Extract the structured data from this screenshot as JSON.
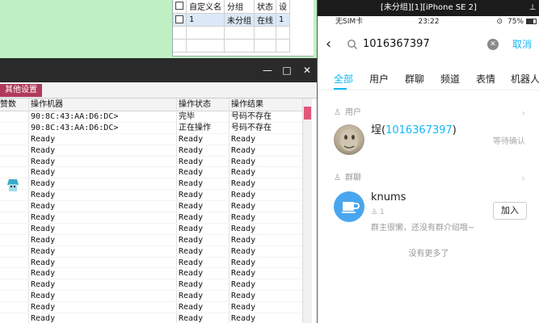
{
  "top_table": {
    "headers": [
      "",
      "自定义名",
      "分组",
      "状态",
      "设"
    ],
    "row": {
      "name": "1",
      "group": "未分组",
      "status": "在线",
      "extra": "1"
    }
  },
  "main_window": {
    "menu_tab": "其他设置",
    "columns": [
      "赞数",
      "操作机器",
      "操作状态",
      "操作结果"
    ],
    "rows": [
      {
        "machine": "90:8C:43:AA:D6:DC>",
        "state": "完毕",
        "result": "号码不存在"
      },
      {
        "machine": "90:8C:43:AA:D6:DC>",
        "state": "正在操作",
        "result": "号码不存在"
      },
      {
        "machine": "Ready",
        "state": "Ready",
        "result": "Ready"
      },
      {
        "machine": "Ready",
        "state": "Ready",
        "result": "Ready"
      },
      {
        "machine": "Ready",
        "state": "Ready",
        "result": "Ready"
      },
      {
        "machine": "Ready",
        "state": "Ready",
        "result": "Ready"
      },
      {
        "machine": "Ready",
        "state": "Ready",
        "result": "Ready"
      },
      {
        "machine": "Ready",
        "state": "Ready",
        "result": "Ready"
      },
      {
        "machine": "Ready",
        "state": "Ready",
        "result": "Ready"
      },
      {
        "machine": "Ready",
        "state": "Ready",
        "result": "Ready"
      },
      {
        "machine": "Ready",
        "state": "Ready",
        "result": "Ready"
      },
      {
        "machine": "Ready",
        "state": "Ready",
        "result": "Ready"
      },
      {
        "machine": "Ready",
        "state": "Ready",
        "result": "Ready"
      },
      {
        "machine": "Ready",
        "state": "Ready",
        "result": "Ready"
      },
      {
        "machine": "Ready",
        "state": "Ready",
        "result": "Ready"
      },
      {
        "machine": "Ready",
        "state": "Ready",
        "result": "Ready"
      },
      {
        "machine": "Ready",
        "state": "Ready",
        "result": "Ready"
      },
      {
        "machine": "Ready",
        "state": "Ready",
        "result": "Ready"
      },
      {
        "machine": "Ready",
        "state": "Ready",
        "result": "Ready"
      }
    ],
    "window_buttons": {
      "minimize": "—",
      "maximize": "□",
      "close": "✕"
    }
  },
  "phone": {
    "title": "[未分组][1][iPhone SE 2]",
    "pin_icon": "pin-icon",
    "status": {
      "carrier": "无SIM卡",
      "time": "23:22",
      "battery": "75%"
    },
    "search": {
      "query": "1016367397",
      "cancel": "取消"
    },
    "tabs": [
      "全部",
      "用户",
      "群聊",
      "频道",
      "表情",
      "机器人"
    ],
    "active_tab": 0,
    "sections": {
      "users": "用户",
      "groups": "群聊"
    },
    "user": {
      "name_prefix": "埕(",
      "name_highlight": "1016367397",
      "name_suffix": ")",
      "status": "等待确认"
    },
    "group": {
      "name": "knums",
      "members": "1",
      "desc": "群主很懒，还没有群介绍哦~",
      "join": "加入"
    },
    "no_more": "没有更多了",
    "accent_color": "#12b7f5"
  }
}
